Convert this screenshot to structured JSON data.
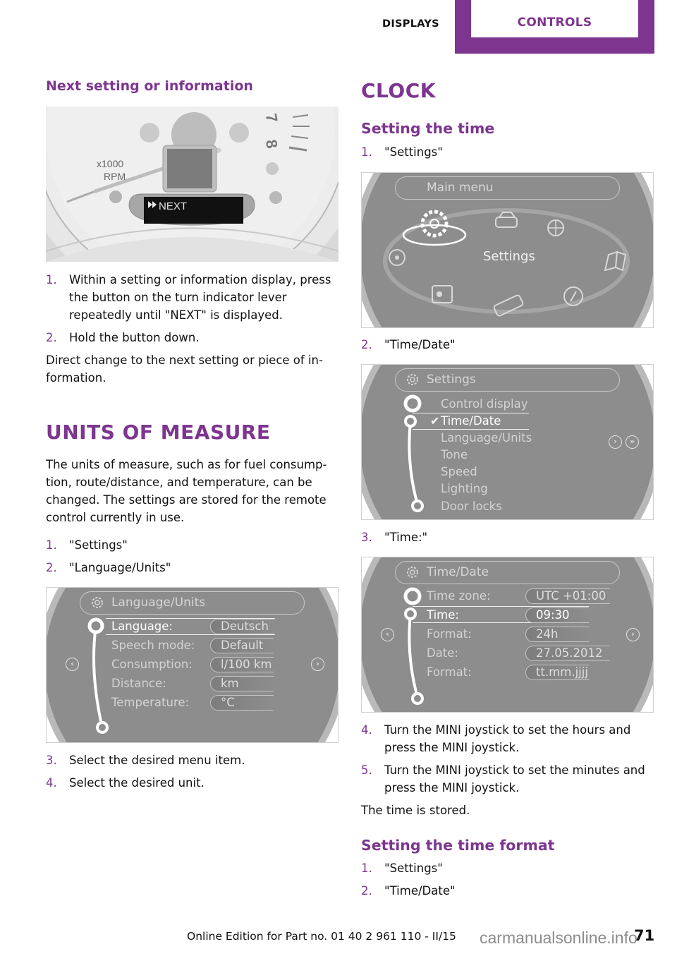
{
  "header": {
    "section_label": "DISPLAYS",
    "chapter_tab": "CONTROLS",
    "accent_color": "#7d3590"
  },
  "left": {
    "next_setting": {
      "heading": "Next setting or information",
      "figure": {
        "rpm_label_1": "x1000",
        "rpm_label_2": "RPM",
        "display_text": "NEXT",
        "display_icon": "fast-forward-icon"
      },
      "steps": [
        {
          "num": "1.",
          "text": "Within a setting or information display, press the button on the turn indicator lever repeatedly until \"NEXT\" is displayed."
        },
        {
          "num": "2.",
          "text": "Hold the button down."
        }
      ],
      "note": "Direct change to the next setting or piece of in-formation."
    },
    "units": {
      "heading": "UNITS OF MEASURE",
      "intro": "The units of measure, such as for fuel consump-tion, route/distance, and temperature, can be changed. The settings are stored for the remote control currently in use.",
      "steps_a": [
        {
          "num": "1.",
          "text": "\"Settings\""
        },
        {
          "num": "2.",
          "text": "\"Language/Units\""
        }
      ],
      "screen": {
        "title": "Language/Units",
        "rows": [
          {
            "label": "Language:",
            "value": "Deutsch",
            "selected": true
          },
          {
            "label": "Speech mode:",
            "value": "Default"
          },
          {
            "label": "Consumption:",
            "value": "l/100 km"
          },
          {
            "label": "Distance:",
            "value": "km"
          },
          {
            "label": "Temperature:",
            "value": "°C"
          }
        ]
      },
      "steps_b": [
        {
          "num": "3.",
          "text": "Select the desired menu item."
        },
        {
          "num": "4.",
          "text": "Select the desired unit."
        }
      ]
    }
  },
  "right": {
    "clock_heading": "CLOCK",
    "setting_time": {
      "heading": "Setting the time",
      "step1": {
        "num": "1.",
        "text": "\"Settings\""
      },
      "main_menu_screen": {
        "title": "Main menu",
        "center_label": "Settings",
        "icons": [
          "settings-gear-icon",
          "vehicle-info-icon",
          "navigation-globe-icon",
          "manual-book-icon",
          "compass-icon",
          "phone-icon",
          "radio-icon",
          "media-cd-icon"
        ]
      },
      "step2": {
        "num": "2.",
        "text": "\"Time/Date\""
      },
      "settings_screen": {
        "title": "Settings",
        "items": [
          "Control display",
          "Time/Date",
          "Language/Units",
          "Tone",
          "Speed",
          "Lighting",
          "Door locks"
        ],
        "selected_index": 1
      },
      "step3": {
        "num": "3.",
        "text": "\"Time:\""
      },
      "timedate_screen": {
        "title": "Time/Date",
        "rows": [
          {
            "label": "Time zone:",
            "value": "UTC +01:00"
          },
          {
            "label": "Time:",
            "value": "09:30",
            "selected": true
          },
          {
            "label": "Format:",
            "value": "24h"
          },
          {
            "label": "Date:",
            "value": "27.05.2012"
          },
          {
            "label": "Format:",
            "value": "tt.mm.jjjj"
          }
        ]
      },
      "steps_after": [
        {
          "num": "4.",
          "text": "Turn the MINI joystick to set the hours and press the MINI joystick."
        },
        {
          "num": "5.",
          "text": "Turn the MINI joystick to set the minutes and press the MINI joystick."
        }
      ],
      "note": "The time is stored."
    },
    "time_format": {
      "heading": "Setting the time format",
      "steps": [
        {
          "num": "1.",
          "text": "\"Settings\""
        },
        {
          "num": "2.",
          "text": "\"Time/Date\""
        }
      ]
    }
  },
  "footer": {
    "edition": "Online Edition for Part no. 01 40 2 961 110 - II/15",
    "page_number": "71",
    "watermark": "carmanualsonline.info"
  }
}
